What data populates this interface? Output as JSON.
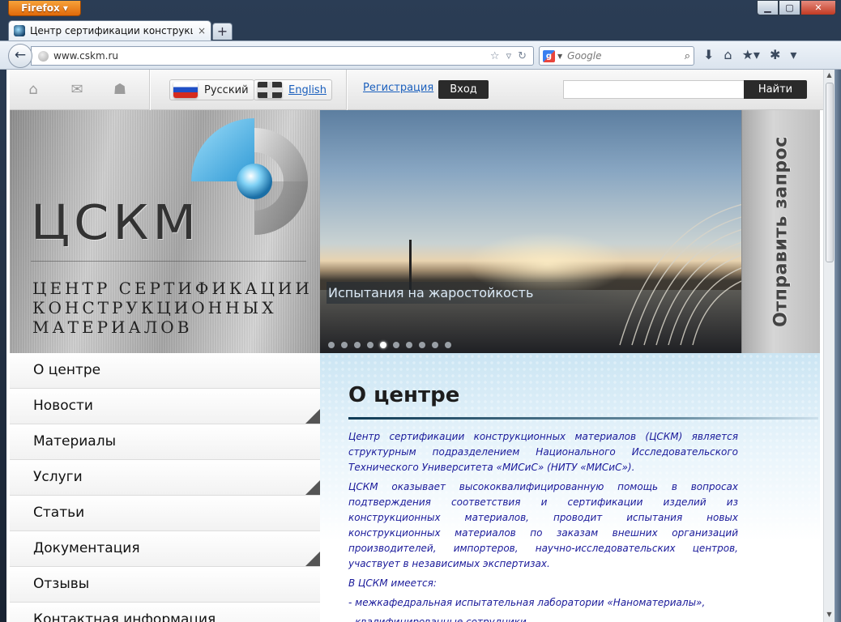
{
  "browser": {
    "app_button": "Firefox ▾",
    "tab_title": "Центр сертификации конструкционны...",
    "tab_close": "×",
    "newtab": "+",
    "url": "www.cskm.ru",
    "search_engine_placeholder": "Google"
  },
  "site_header": {
    "lang_ru": "Русский",
    "lang_en": "English",
    "register_link": "Регистрация",
    "login_button": "Вход",
    "search_button": "Найти",
    "search_value": ""
  },
  "logo": {
    "letters": "ЦСКМ",
    "subtitle_lines": [
      "Центр сертификации",
      "конструкционных",
      "материалов"
    ]
  },
  "slider": {
    "caption": "Испытания на жаростойкость",
    "dot_count": 10,
    "active_dot": 4
  },
  "request_tab": "Отправить запрос",
  "menu": {
    "items": [
      {
        "label": "О центре",
        "sub": false
      },
      {
        "label": "Новости",
        "sub": true
      },
      {
        "label": "Материалы",
        "sub": false
      },
      {
        "label": "Услуги",
        "sub": true
      },
      {
        "label": "Статьи",
        "sub": false
      },
      {
        "label": "Документация",
        "sub": true
      },
      {
        "label": "Отзывы",
        "sub": false
      },
      {
        "label": "Контактная информация",
        "sub": false
      }
    ]
  },
  "content": {
    "title": "О центре",
    "p1": "Центр сертификации конструкционных материалов (ЦСКМ) является структурным подразделением Национального Исследовательского Технического Университета «МИСиС» (НИТУ «МИСиС»).",
    "p2": "ЦСКМ оказывает высококвалифицированную помощь в вопросах подтверждения соответствия и сертификации изделий из конструкционных материалов, проводит испытания новых конструкционных материалов по заказам внешних организаций производителей, импортеров, научно-исследовательских центров, участвует в независимых экспертизах.",
    "p3": "В ЦСКМ имеется:",
    "p4": "- межкафедральная  испытательная лаборатории «Наноматериалы»,",
    "p5": "- квалифицированные сотрудники,"
  }
}
